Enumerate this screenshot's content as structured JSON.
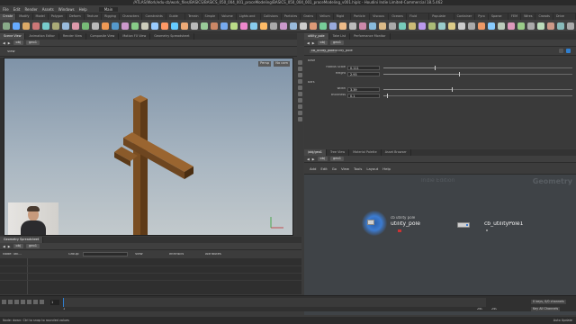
{
  "window": {
    "title": "/ATLAS/Work/edu-cb/work_files/BASICS/BASICS_050_004_001_proceModeling/BASICS_050_004_001_proceModeling_v001.hiplc - Houdini Indie Limited-Commercial 18.5.462"
  },
  "menu": {
    "items": [
      "File",
      "Edit",
      "Render",
      "Assets",
      "Windows",
      "Help"
    ],
    "build": "Main"
  },
  "shelf_tabs": [
    "Create",
    "Modify",
    "Model",
    "Polygon",
    "Deform",
    "Texture",
    "Rigging",
    "Characters",
    "Constraints",
    "Guide Process",
    "Terrain FX",
    "Simple FX",
    "Volume",
    "Lights and Cameras",
    "Collisions",
    "Particles",
    "Grains",
    "Vellum",
    "Rigid Bodies",
    "Particle Fluids",
    "Viscous Fluids",
    "Oceans",
    "Fluid Containers",
    "Populate Containers",
    "Container Tools",
    "Pyro FX",
    "Sparse Pyro FX",
    "FEM",
    "Wires",
    "Crowds",
    "Drive Simulation"
  ],
  "left_pane": {
    "tabs": [
      "Scene View",
      "Animation Editor",
      "Render View",
      "Composite View",
      "Motion FX View",
      "Geometry Spreadsheet"
    ],
    "path": [
      "obj",
      "geo1"
    ],
    "view_label": "View",
    "persp_label": "Persp",
    "cam_label": "No cam"
  },
  "right_top": {
    "tabs": [
      "utility_pole",
      "Take List",
      "Performance Monitor"
    ],
    "path": [
      "obj",
      "geo1"
    ],
    "node_type": "cb_utility_pole",
    "node_name": "utility_pole",
    "sections": [
      {
        "name": "Base",
        "params": [
          {
            "label": "Radius Scale",
            "value": "0.111",
            "fraction": 0.27
          },
          {
            "label": "Height",
            "value": "2.93",
            "fraction": 0.4
          }
        ]
      },
      {
        "name": "Bars",
        "params": [
          {
            "label": "width",
            "value": "3.39",
            "fraction": 0.36
          },
          {
            "label": "thickness",
            "value": "0.1",
            "fraction": 0.02
          }
        ]
      }
    ]
  },
  "right_bottom": {
    "tabs": [
      "/obj/geo1",
      "Tree View",
      "Material Palette",
      "Asset Browser"
    ],
    "menu": [
      "Add",
      "Edit",
      "Go",
      "View",
      "Tools",
      "Layout",
      "Help"
    ],
    "path": [
      "obj",
      "geo1"
    ],
    "watermark_left": "Indie Edition",
    "watermark_right": "Geometry",
    "nodes": [
      {
        "type_label": "cb utility pole",
        "name": "utility_pole"
      },
      {
        "type_label": "",
        "name": "cb_utilityPole1"
      }
    ]
  },
  "spreadsheet": {
    "tabs": [
      "Geometry Spreadsheet"
    ],
    "path": [
      "obj",
      "geo1"
    ],
    "node_label": "Node: util...",
    "group_label": "Group:",
    "view_label": "View",
    "intrinsics_label": "Intrinsics",
    "attributes_label": "Attributes"
  },
  "timeline": {
    "frame": "1",
    "start": "1",
    "end": "240",
    "end2": "240",
    "keys_label": "0 keys, 0/0 channels",
    "key_all": "Key All Channels",
    "auto_update": "Auto Update"
  },
  "status": {
    "text": "Node: down: Ctrl to snap to rounded values"
  }
}
